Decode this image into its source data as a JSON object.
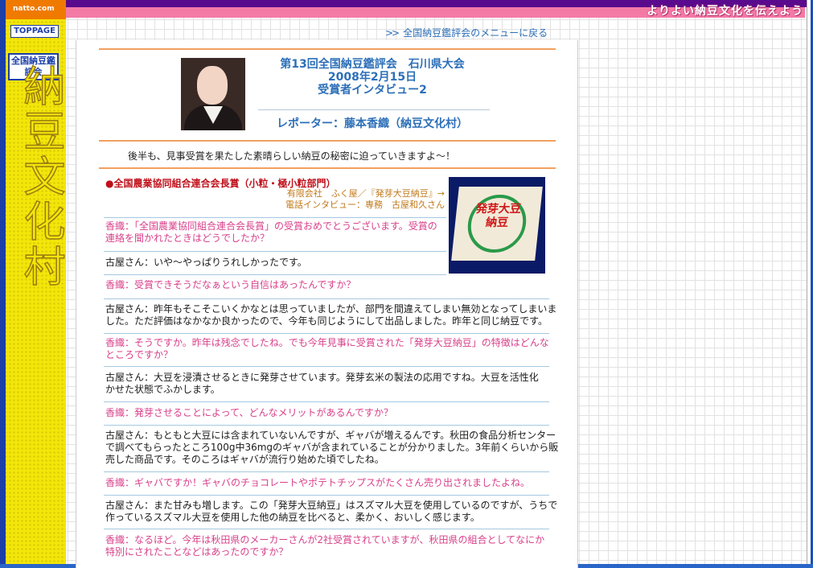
{
  "site": {
    "logo": "natto.com",
    "tagline": "よりよい納豆文化を伝えよう",
    "toppage_label": "TOPPAGE",
    "kanteikai_label": "全国納豆鑑評会",
    "vertical_title": "納豆文化村"
  },
  "nav": {
    "menu_link": "全国納豆鑑評会のメニューに戻る",
    "menu_arrow": ">>"
  },
  "header": {
    "title_line1": "第13回全国納豆鑑評会　石川県大会",
    "title_line2": "2008年2月15日",
    "title_line3": "受賞者インタビュー2",
    "reporter": "レポーター：藤本香織（納豆文化村）"
  },
  "intro": "後半も、見事受賞を果たした素晴らしい納豆の秘密に迫っていきますよ～！",
  "award": {
    "title": "●全国農業協同組合連合会長賞（小粒・極小粒部門）",
    "company_line1": "有限会社　ふく屋／『発芽大豆納豆』→",
    "company_line2": "電話インタビュー：専務　古屋和久さん",
    "product_text": "発芽大豆納豆"
  },
  "qa": [
    {
      "type": "q",
      "lines": [
        "香織：「全国農業協同組合連合会長賞」の受賞おめでとうございます。受賞の",
        "連絡を聞かれたときはどうでしたか？"
      ]
    },
    {
      "type": "a",
      "lines": [
        "古屋さん：いや～やっぱりうれしかったです。"
      ]
    },
    {
      "type": "q",
      "lines": [
        "香織：受賞できそうだなぁという自信はあったんですか？"
      ]
    },
    {
      "type": "a",
      "lines": [
        "古屋さん：昨年もそこそこいくかなとは思っていましたが、部門を間違えてしまい無効となってしまいま",
        "した。ただ評価はなかなか良かったので、今年も同じようにして出品しました。昨年と同じ納豆です。"
      ]
    },
    {
      "type": "q",
      "lines": [
        "香織：そうですか。昨年は残念でしたね。でも今年見事に受賞された「発芽大豆納豆」の特徴はどんな",
        "ところですか？"
      ]
    },
    {
      "type": "a",
      "lines": [
        "古屋さん：大豆を浸漬させるときに発芽させています。発芽玄米の製法の応用ですね。大豆を活性化",
        "かせた状態でふかします。"
      ]
    },
    {
      "type": "q",
      "lines": [
        "香織：発芽させることによって、どんなメリットがあるんですか？"
      ]
    },
    {
      "type": "a",
      "lines": [
        "古屋さん：もともと大豆には含まれていないんですが、ギャバが増えるんです。秋田の食品分析センター",
        "で調べてもらったところ100g中36mgのギャバが含まれていることが分かりました。3年前くらいから販",
        "売した商品です。そのころはギャバが流行り始めた頃でしたね。"
      ]
    },
    {
      "type": "q",
      "lines": [
        "香織：ギャバですか！ギャバのチョコレートやポテトチップスがたくさん売り出されましたよね。"
      ]
    },
    {
      "type": "a",
      "lines": [
        "古屋さん：また甘みも増します。この「発芽大豆納豆」はスズマル大豆を使用しているのですが、うちで",
        "作っているスズマル大豆を使用した他の納豆を比べると、柔かく、おいしく感じます。"
      ]
    },
    {
      "type": "q",
      "lines": [
        "香織：なるほど。今年は秋田県のメーカーさんが2社受賞されていますが、秋田県の組合としてなにか",
        "特別にされたことなどはあったのですか？"
      ]
    }
  ],
  "colors": {
    "accent_blue": "#2c6fb8",
    "question_pink": "#d8408a",
    "award_red": "#c0101a",
    "sidebar_yellow": "#f2e60a"
  }
}
